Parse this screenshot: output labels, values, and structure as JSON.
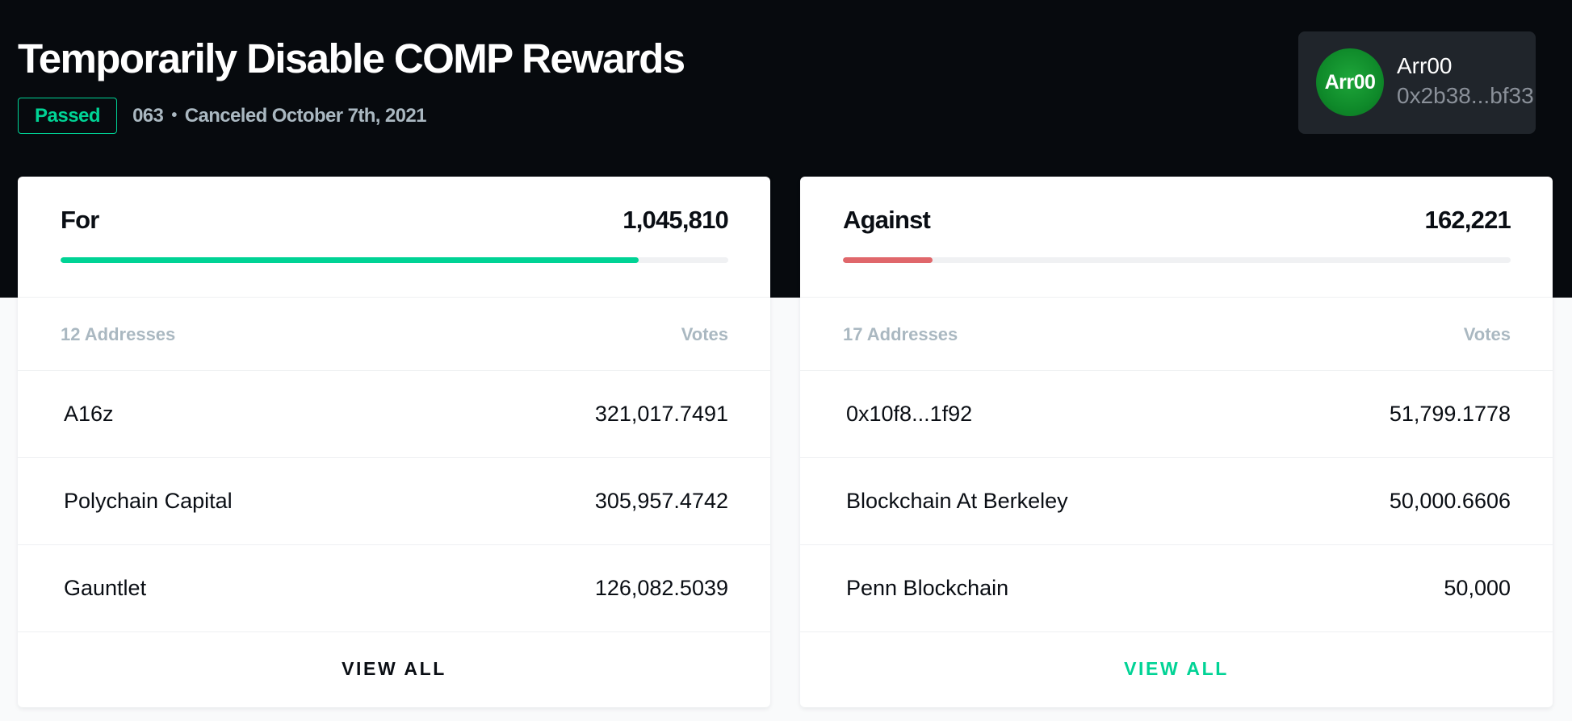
{
  "proposal": {
    "title": "Temporarily Disable COMP Rewards",
    "status": "Passed",
    "id": "063",
    "separator": "•",
    "state_text": "Canceled October 7th, 2021"
  },
  "proposer": {
    "avatar_text": "Arr00",
    "name": "Arr00",
    "address": "0x2b38...bf33"
  },
  "for": {
    "label": "For",
    "total": "1,045,810",
    "progress_fraction": 0.866,
    "address_count": "12 Addresses",
    "votes_header": "Votes",
    "rows": [
      {
        "name": "A16z",
        "votes": "321,017.7491"
      },
      {
        "name": "Polychain Capital",
        "votes": "305,957.4742"
      },
      {
        "name": "Gauntlet",
        "votes": "126,082.5039"
      }
    ],
    "view_all": "VIEW ALL"
  },
  "against": {
    "label": "Against",
    "total": "162,221",
    "progress_fraction": 0.134,
    "address_count": "17 Addresses",
    "votes_header": "Votes",
    "rows": [
      {
        "name": "0x10f8...1f92",
        "votes": "51,799.1778"
      },
      {
        "name": "Blockchain At Berkeley",
        "votes": "50,000.6606"
      },
      {
        "name": "Penn Blockchain",
        "votes": "50,000"
      }
    ],
    "view_all": "VIEW ALL"
  },
  "colors": {
    "hero_bg": "#070a0e",
    "accent_green": "#00d395",
    "against_red": "#e0676b",
    "view_all_dark": "#0a0e14",
    "muted": "#aab8c1"
  }
}
